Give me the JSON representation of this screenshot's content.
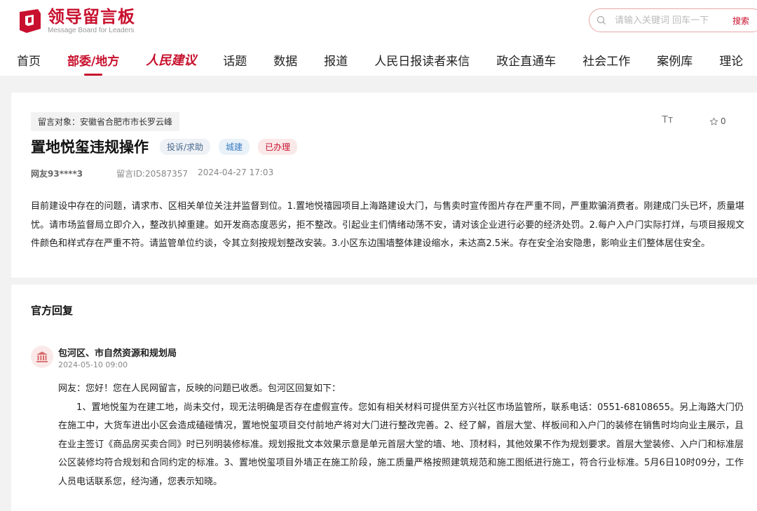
{
  "header": {
    "logo_title": "领导留言板",
    "logo_subtitle": "Message Board for Leaders",
    "search_placeholder": "请输入关键词 回车一下",
    "search_button": "搜索"
  },
  "nav": [
    {
      "label": "首页"
    },
    {
      "label": "部委/地方",
      "active": true
    },
    {
      "label": "人民建议"
    },
    {
      "label": "话题"
    },
    {
      "label": "数据"
    },
    {
      "label": "报道"
    },
    {
      "label": "人民日报读者来信"
    },
    {
      "label": "政企直通车"
    },
    {
      "label": "社会工作"
    },
    {
      "label": "案例库"
    },
    {
      "label": "理论"
    }
  ],
  "message": {
    "target": "留言对象：安徽省合肥市市长罗云峰",
    "font_toggle": "Tт",
    "favorite_count": "0",
    "title": "置地悦玺违规操作",
    "tags": [
      "投诉/求助",
      "城建",
      "已办理"
    ],
    "user": "网友93****3",
    "message_id": "留言ID:20587357",
    "datetime": "2024-04-27 17:03",
    "content": "目前建设中存在的问题，请求市、区相关单位关注并监督到位。1.置地悦禧园项目上海路建设大门，与售卖时宣传图片存在严重不同，严重欺骗消费者。刚建成门头已坏，质量堪忧。请市场监督局立即介入，整改扒掉重建。如开发商态度恶劣，拒不整改。引起业主们情绪动荡不安，请对该企业进行必要的经济处罚。2.每户入户门实际打烊，与项目报规文件颜色和样式存在严重不符。请监管单位约谈，令其立刻按规划整改安装。3.小区东边围墙整体建设缩水，未达高2.5米。存在安全治安隐患，影响业主们整体居住安全。"
  },
  "reply": {
    "section_title": "官方回复",
    "org_name": "包河区、市自然资源和规划局",
    "date": "2024-05-10 09:00",
    "greeting": "网友：您好！您在人民网留言，反映的问题已收悉。包河区回复如下：",
    "body": "1、置地悦玺为在建工地，尚未交付，现无法明确是否存在虚假宣传。您如有相关材料可提供至方兴社区市场监管所，联系电话：0551-68108655。另上海路大门仍在施工中，大货车进出小区会造成磕碰情况，置地悦玺项目交付前地产将对大门进行整改完善。2、经了解，首层大堂、样板间和入户门的装修在销售时均向业主展示，且在业主签订《商品房买卖合同》时已列明装修标准。规划报批文本效果示意是单元首层大堂的墙、地、顶材料，其他效果不作为规划要求。首层大堂装修、入户门和标准层公区装修均符合规划和合同约定的标准。3、置地悦玺项目外墙正在施工阶段，施工质量严格按照建筑规范和施工图纸进行施工，符合行业标准。5月6日10时09分，工作人员电话联系您，经沟通，您表示知晓。"
  },
  "colors": {
    "brand_red": "#c8102e",
    "background": "#f2f2f2"
  }
}
